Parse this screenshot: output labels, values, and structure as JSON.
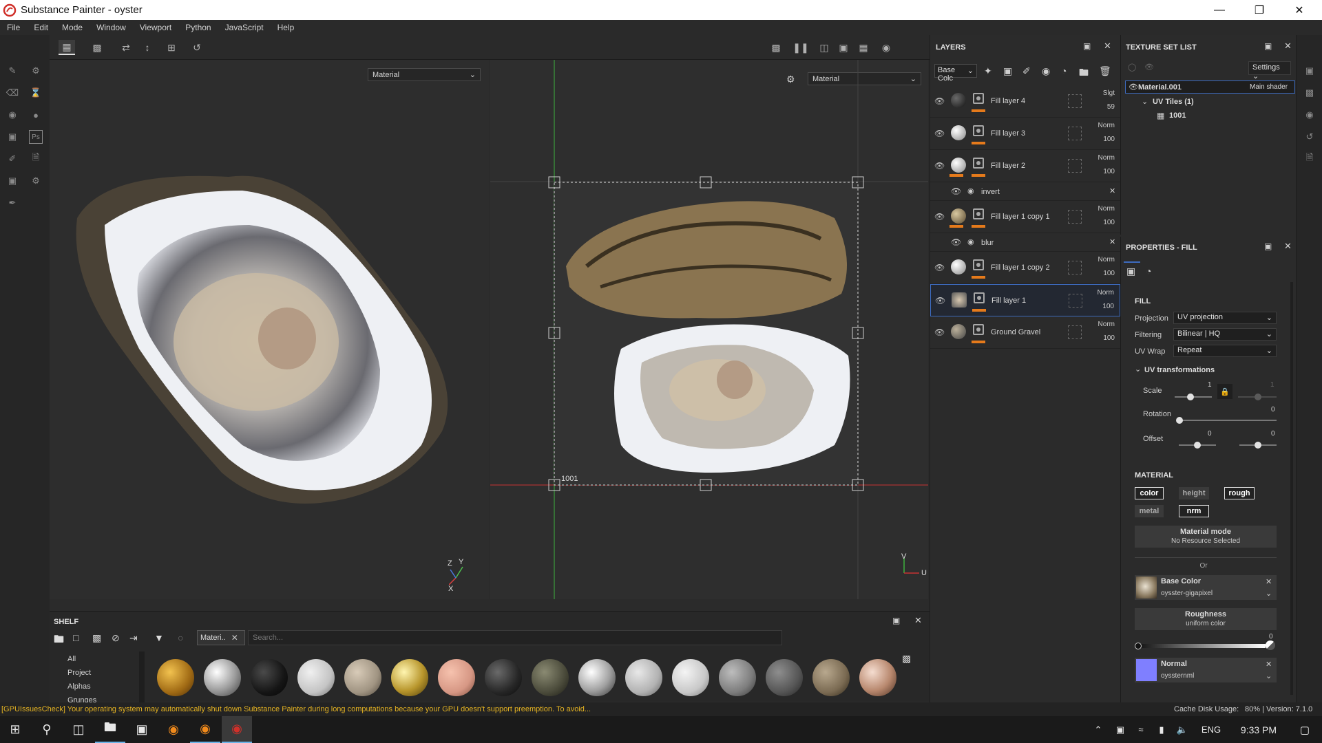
{
  "window": {
    "title": "Substance Painter - oyster"
  },
  "menu": [
    "File",
    "Edit",
    "Mode",
    "Window",
    "Viewport",
    "Python",
    "JavaScript",
    "Help"
  ],
  "viewport3d": {
    "dropdown": "Material"
  },
  "viewport2d": {
    "dropdown": "Material",
    "uv_tile_label": "1001",
    "axis_v": "V",
    "axis_u": "U"
  },
  "axis3d": {
    "z": "Z",
    "y": "Y",
    "x": "X"
  },
  "shelf": {
    "title": "SHELF",
    "filter_tag": "Materi..",
    "search_placeholder": "Search...",
    "categories": [
      "All",
      "Project",
      "Alphas",
      "Grunges"
    ]
  },
  "layers": {
    "title": "LAYERS",
    "channel": "Base Colc",
    "items": [
      {
        "name": "Fill layer 4",
        "blend": "Slgt",
        "opacity": "59"
      },
      {
        "name": "Fill layer 3",
        "blend": "Norm",
        "opacity": "100"
      },
      {
        "name": "Fill layer 2",
        "blend": "Norm",
        "opacity": "100"
      },
      {
        "name": "Fill layer 1 copy 1",
        "blend": "Norm",
        "opacity": "100"
      },
      {
        "name": "Fill layer 1 copy 2",
        "blend": "Norm",
        "opacity": "100"
      },
      {
        "name": "Fill layer 1",
        "blend": "Norm",
        "opacity": "100"
      },
      {
        "name": "Ground Gravel",
        "blend": "Norm",
        "opacity": "100"
      }
    ],
    "effects": [
      "invert",
      "blur"
    ]
  },
  "texture_set_list": {
    "title": "TEXTURE SET LIST",
    "settings_label": "Settings",
    "material": "Material.001",
    "shader": "Main shader",
    "uv_tiles": "UV Tiles (1)",
    "tile": "1001"
  },
  "properties": {
    "title": "PROPERTIES - FILL",
    "fill_header": "FILL",
    "projection_label": "Projection",
    "projection_value": "UV projection",
    "filtering_label": "Filtering",
    "filtering_value": "Bilinear | HQ",
    "uvwrap_label": "UV Wrap",
    "uvwrap_value": "Repeat",
    "uv_transform_header": "UV transformations",
    "scale_label": "Scale",
    "scale_value": "1",
    "scale_value2": "1",
    "rotation_label": "Rotation",
    "rotation_value": "0",
    "offset_label": "Offset",
    "offset_x": "0",
    "offset_y": "0",
    "material_header": "MATERIAL",
    "channels": [
      "color",
      "height",
      "rough",
      "metal",
      "nrm"
    ],
    "material_mode_label": "Material mode",
    "material_mode_value": "No Resource Selected",
    "or_label": "Or",
    "base_color_label": "Base Color",
    "base_color_resource": "oysster-gigapixel",
    "roughness_label": "Roughness",
    "roughness_resource": "uniform color",
    "roughness_value": "0",
    "normal_label": "Normal",
    "normal_resource": "oyssternml"
  },
  "status": {
    "message": "[GPUIssuesCheck] Your operating system may automatically shut down Substance Painter during long computations because your GPU doesn't support preemption. To avoid...",
    "cache": "Cache Disk Usage:",
    "version": "80% | Version: 7.1.0"
  },
  "taskbar": {
    "lang": "ENG",
    "time": "9:33 PM"
  }
}
